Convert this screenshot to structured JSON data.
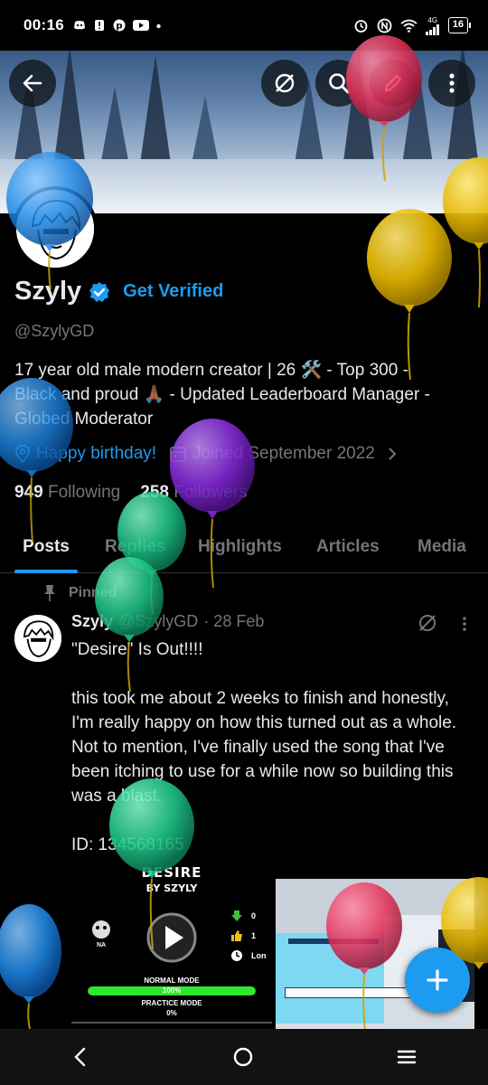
{
  "status_bar": {
    "time": "00:16",
    "network_label": "4G",
    "battery": "16",
    "icons": [
      "discord-icon",
      "alert-icon",
      "pinterest-icon",
      "youtube-icon",
      "dot-icon",
      "alarm-icon",
      "nfc-icon",
      "wifi-icon",
      "signal-icon"
    ]
  },
  "header": {
    "back_icon": "back-arrow-icon",
    "grok_icon": "grok-icon",
    "search_icon": "search-icon",
    "edit_icon": "edit-icon",
    "more_icon": "more-vertical-icon"
  },
  "profile": {
    "name": "Szyly",
    "get_verified_label": "Get Verified",
    "handle": "@SzylyGD",
    "bio_line1": "17 year old male modern creator | 26 🛠️ - Top 300 -",
    "bio_line2": "Black and proud 🙏🏾 - Updated Leaderboard Manager -",
    "bio_line3": "Globed Moderator",
    "birthday_text": "Happy birthday!",
    "joined_text": "Joined September 2022",
    "following_count": "949",
    "following_label": "Following",
    "followers_count": "258",
    "followers_label": "Followers"
  },
  "tabs": [
    {
      "label": "Posts",
      "active": true
    },
    {
      "label": "Replies",
      "active": false
    },
    {
      "label": "Highlights",
      "active": false
    },
    {
      "label": "Articles",
      "active": false
    },
    {
      "label": "Media",
      "active": false
    }
  ],
  "post": {
    "pinned_label": "Pinned",
    "author_name": "Szyly",
    "author_handle": "@SzylyGD",
    "date": "· 28 Feb",
    "text": "\"Desire\" Is Out!!!!\n\nthis took me about 2 weeks to finish and honestly, I'm really happy on how this turned out as a whole. Not to mention, I've finally used the song that I've been itching to use for a while now so building this was a blast.\n\nID: 134568165",
    "media": {
      "level_title": "Desire",
      "level_author": "By Szyly",
      "difficulty": "NA",
      "downloads": "0",
      "likes": "1",
      "length": "Lon",
      "normal_mode_label": "Normal Mode",
      "normal_percent": "100%",
      "practice_mode_label": "Practice Mode",
      "practice_percent": "0%",
      "normal_progress": 1.0,
      "practice_progress": 0.0
    }
  },
  "fab_icon": "plus-icon",
  "nav": {
    "back_icon": "nav-back-icon",
    "home_icon": "nav-home-icon",
    "recents_icon": "nav-recents-icon"
  },
  "colors": {
    "accent": "#1d9bf0",
    "balloon_blue": "#1e88e5",
    "balloon_yellow": "#e6b800",
    "balloon_red": "#e8325a",
    "balloon_green": "#1fc98c",
    "balloon_purple": "#8a2be2"
  }
}
